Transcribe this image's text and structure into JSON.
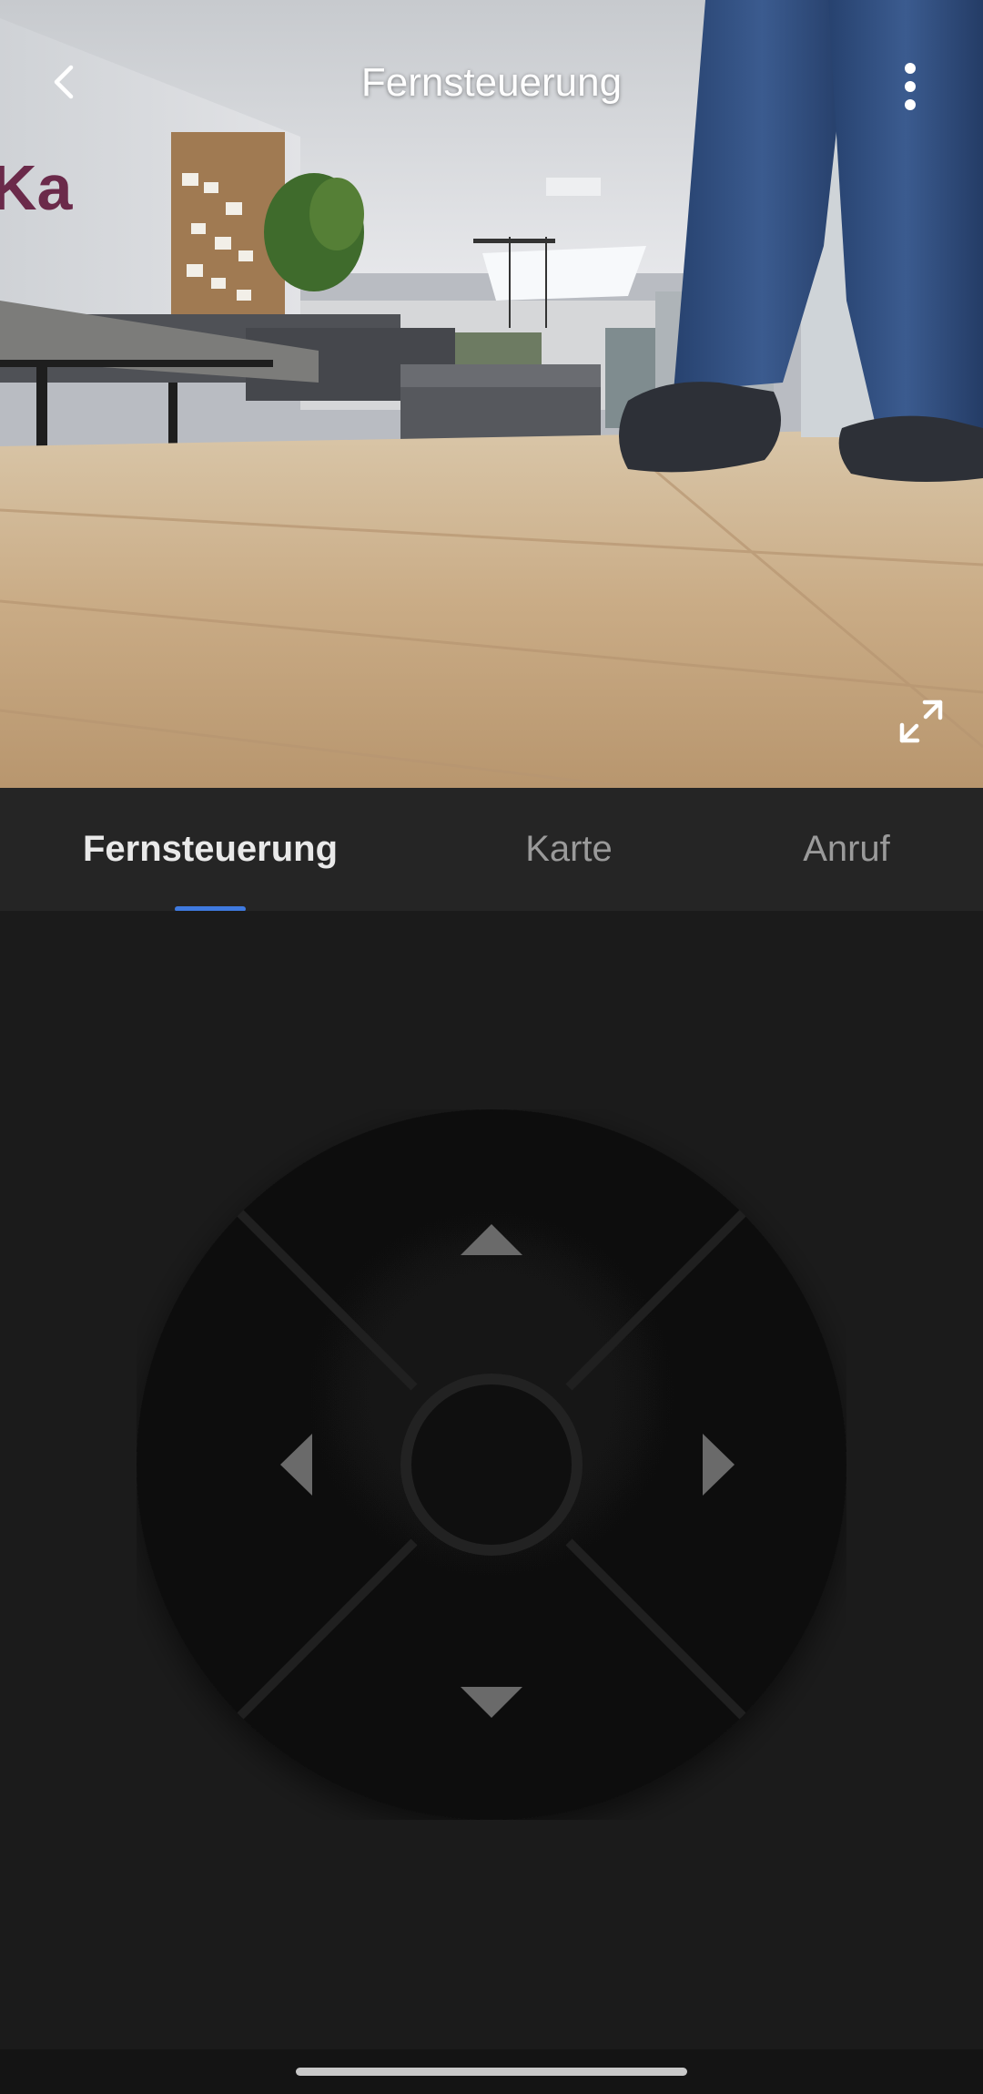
{
  "header": {
    "title": "Fernsteuerung",
    "back_icon": "chevron-left-icon",
    "more_icon": "more-vertical-icon"
  },
  "video": {
    "fullscreen_icon": "expand-icon"
  },
  "tabs": [
    {
      "label": "Fernsteuerung",
      "active": true
    },
    {
      "label": "Karte",
      "active": false
    },
    {
      "label": "Anruf",
      "active": false
    }
  ],
  "dpad": {
    "up_icon": "arrow-up-icon",
    "down_icon": "arrow-down-icon",
    "left_icon": "arrow-left-icon",
    "right_icon": "arrow-right-icon"
  },
  "colors": {
    "accent": "#3f7ae0",
    "background": "#1b1b1b",
    "tab_bar": "#252525"
  }
}
